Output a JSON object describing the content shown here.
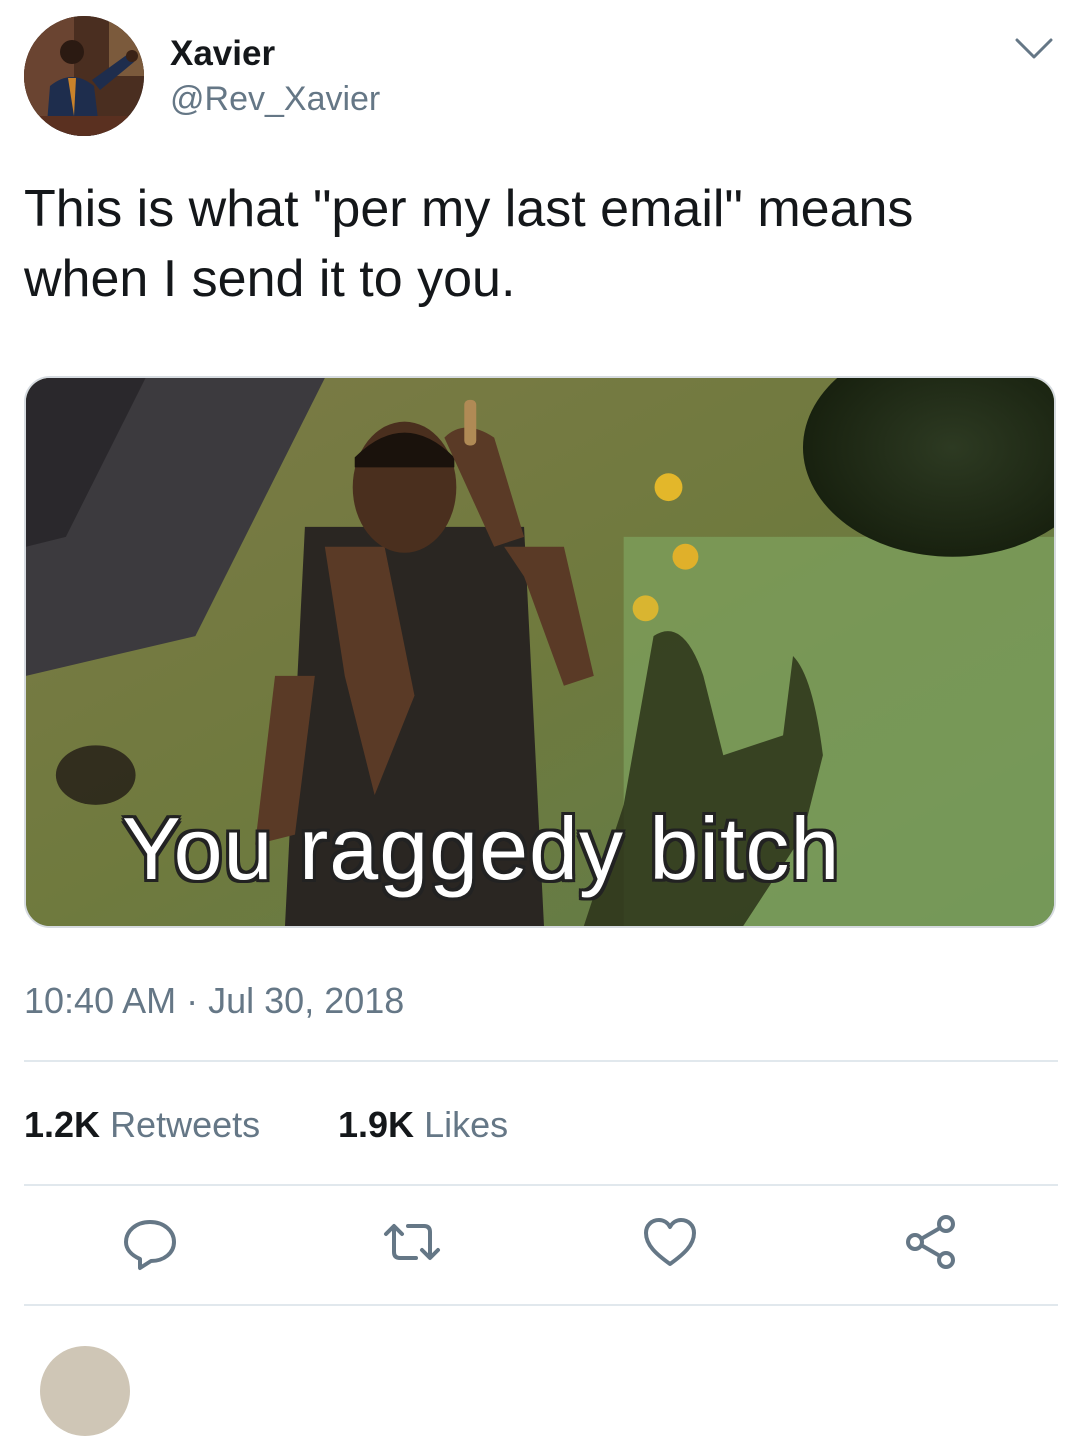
{
  "tweet": {
    "display_name": "Xavier",
    "handle": "@Rev_Xavier",
    "text": "This is what \"per my last email\" means when I send it to you.",
    "media": {
      "caption": "You raggedy bitch"
    },
    "time": "10:40 AM",
    "separator": "·",
    "date": "Jul 30, 2018",
    "stats": {
      "retweets_count": "1.2K",
      "retweets_label": "Retweets",
      "likes_count": "1.9K",
      "likes_label": "Likes"
    }
  },
  "icons": {
    "menu": "chevron-down-icon",
    "reply": "reply-icon",
    "retweet": "retweet-icon",
    "like": "heart-icon",
    "share": "share-icon"
  },
  "colors": {
    "text": "#14171a",
    "secondary": "#657786",
    "divider": "#e1e8ed"
  }
}
